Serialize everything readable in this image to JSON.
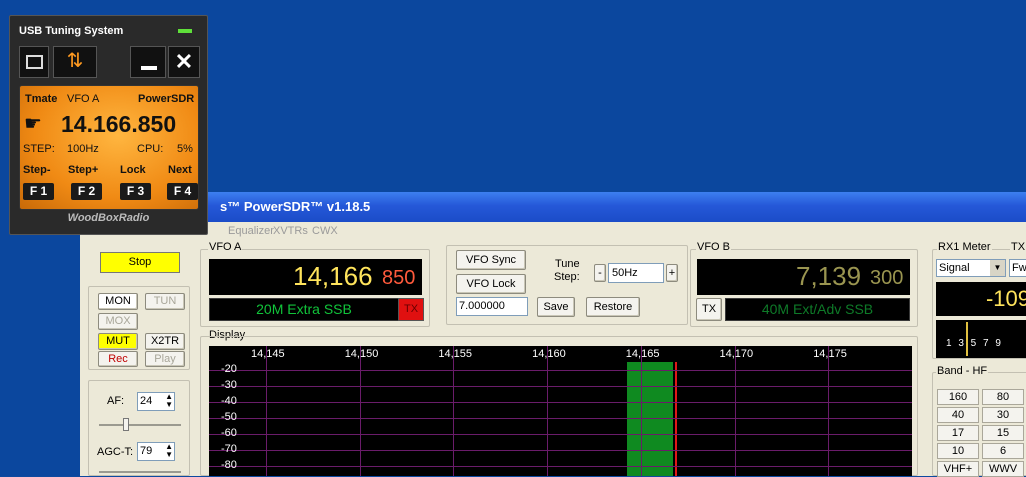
{
  "tmate": {
    "title": "USB Tuning System",
    "header_left": "Tmate",
    "header_vfo": "VFO A",
    "header_right": "PowerSDR",
    "frequency": "14.166.850",
    "step_label": "STEP:",
    "step_value": "100Hz",
    "cpu_label": "CPU:",
    "cpu_value": "5%",
    "fkeys": [
      {
        "label": "Step-",
        "key": "F 1"
      },
      {
        "label": "Step+",
        "key": "F 2"
      },
      {
        "label": "Lock",
        "key": "F 3"
      },
      {
        "label": "Next",
        "key": "F 4"
      }
    ],
    "brand": "WoodBoxRadio"
  },
  "sdr": {
    "title": "s™ PowerSDR™ v1.18.5",
    "menu": [
      "Equalizer",
      "XVTRs",
      "CWX"
    ],
    "stop_label": "Stop",
    "buttons": {
      "mon": "MON",
      "tun": "TUN",
      "mox": "MOX",
      "mut": "MUT",
      "x2tr": "X2TR",
      "rec": "Rec",
      "play": "Play"
    },
    "af_label": "AF:",
    "af_value": "24",
    "agct_label": "AGC-T:",
    "agct_value": "79",
    "vfoa": {
      "label": "VFO A",
      "freq_main": "14,166",
      "freq_sub": "850",
      "mode": "20M Extra SSB",
      "tx": "TX"
    },
    "vfo_sync": "VFO Sync",
    "vfo_lock": "VFO Lock",
    "tune_step_label1": "Tune",
    "tune_step_label2": "Step:",
    "tune_step_value": "50Hz",
    "minus": "-",
    "plus": "+",
    "save_input": "7.000000",
    "save_label": "Save",
    "restore_label": "Restore",
    "vfob": {
      "label": "VFO B",
      "freq_main": "7,139",
      "freq_sub": "300",
      "mode": "40M Ext/Adv SSB",
      "tx": "TX"
    },
    "rx1_meter_label": "RX1 Meter",
    "tx_label": "TX",
    "meter_select": "Signal",
    "tx_select": "Fw",
    "meter_value": "-109",
    "meter_scale": "1 3 5 7 9",
    "display_label": "Display",
    "display_x": [
      "14,145",
      "14,150",
      "14,155",
      "14,160",
      "14,165",
      "14,170",
      "14,175"
    ],
    "display_y": [
      "-20",
      "-30",
      "-40",
      "-50",
      "-60",
      "-70",
      "-80"
    ],
    "band_label": "Band - HF",
    "bands": [
      "160",
      "80",
      "40",
      "30",
      "17",
      "15",
      "10",
      "6",
      "VHF+",
      "WWV"
    ]
  }
}
